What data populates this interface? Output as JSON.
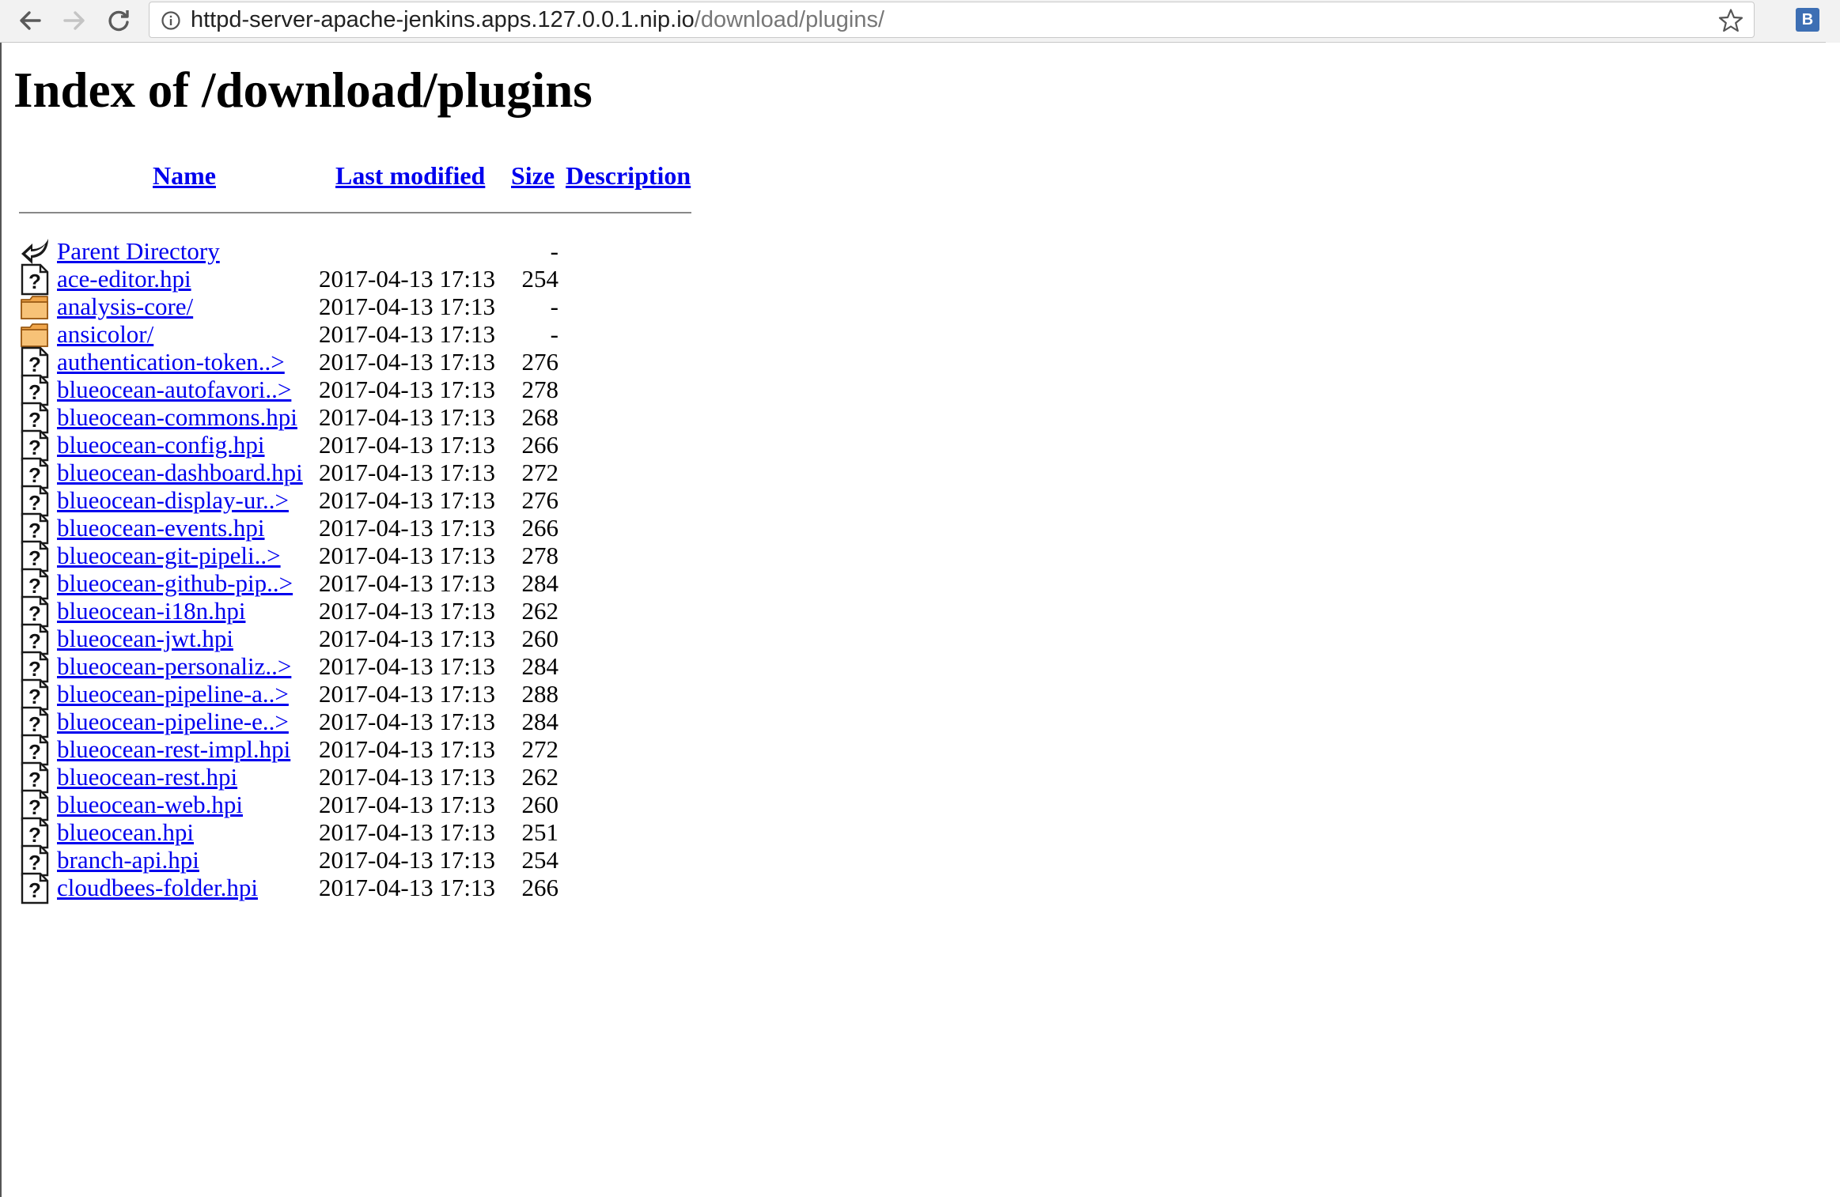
{
  "browser": {
    "url_host": "httpd-server-apache-jenkins.apps.127.0.0.1.nip.io",
    "url_path": "/download/plugins/",
    "extension_label": "B"
  },
  "page": {
    "title": "Index of /download/plugins",
    "columns": {
      "name": "Name",
      "last_modified": "Last modified",
      "size": "Size",
      "description": "Description"
    },
    "parent": {
      "label": "Parent Directory",
      "size": "-"
    },
    "rows": [
      {
        "name": "ace-editor.hpi",
        "date": "2017-04-13 17:13",
        "size": "254",
        "kind": "file"
      },
      {
        "name": "analysis-core/",
        "date": "2017-04-13 17:13",
        "size": "-",
        "kind": "folder"
      },
      {
        "name": "ansicolor/",
        "date": "2017-04-13 17:13",
        "size": "-",
        "kind": "folder"
      },
      {
        "name": "authentication-token..>",
        "date": "2017-04-13 17:13",
        "size": "276",
        "kind": "file"
      },
      {
        "name": "blueocean-autofavori..>",
        "date": "2017-04-13 17:13",
        "size": "278",
        "kind": "file"
      },
      {
        "name": "blueocean-commons.hpi",
        "date": "2017-04-13 17:13",
        "size": "268",
        "kind": "file"
      },
      {
        "name": "blueocean-config.hpi",
        "date": "2017-04-13 17:13",
        "size": "266",
        "kind": "file"
      },
      {
        "name": "blueocean-dashboard.hpi",
        "date": "2017-04-13 17:13",
        "size": "272",
        "kind": "file"
      },
      {
        "name": "blueocean-display-ur..>",
        "date": "2017-04-13 17:13",
        "size": "276",
        "kind": "file"
      },
      {
        "name": "blueocean-events.hpi",
        "date": "2017-04-13 17:13",
        "size": "266",
        "kind": "file"
      },
      {
        "name": "blueocean-git-pipeli..>",
        "date": "2017-04-13 17:13",
        "size": "278",
        "kind": "file"
      },
      {
        "name": "blueocean-github-pip..>",
        "date": "2017-04-13 17:13",
        "size": "284",
        "kind": "file"
      },
      {
        "name": "blueocean-i18n.hpi",
        "date": "2017-04-13 17:13",
        "size": "262",
        "kind": "file"
      },
      {
        "name": "blueocean-jwt.hpi",
        "date": "2017-04-13 17:13",
        "size": "260",
        "kind": "file"
      },
      {
        "name": "blueocean-personaliz..>",
        "date": "2017-04-13 17:13",
        "size": "284",
        "kind": "file"
      },
      {
        "name": "blueocean-pipeline-a..>",
        "date": "2017-04-13 17:13",
        "size": "288",
        "kind": "file"
      },
      {
        "name": "blueocean-pipeline-e..>",
        "date": "2017-04-13 17:13",
        "size": "284",
        "kind": "file"
      },
      {
        "name": "blueocean-rest-impl.hpi",
        "date": "2017-04-13 17:13",
        "size": "272",
        "kind": "file"
      },
      {
        "name": "blueocean-rest.hpi",
        "date": "2017-04-13 17:13",
        "size": "262",
        "kind": "file"
      },
      {
        "name": "blueocean-web.hpi",
        "date": "2017-04-13 17:13",
        "size": "260",
        "kind": "file"
      },
      {
        "name": "blueocean.hpi",
        "date": "2017-04-13 17:13",
        "size": "251",
        "kind": "file"
      },
      {
        "name": "branch-api.hpi",
        "date": "2017-04-13 17:13",
        "size": "254",
        "kind": "file"
      },
      {
        "name": "cloudbees-folder.hpi",
        "date": "2017-04-13 17:13",
        "size": "266",
        "kind": "file"
      }
    ]
  }
}
